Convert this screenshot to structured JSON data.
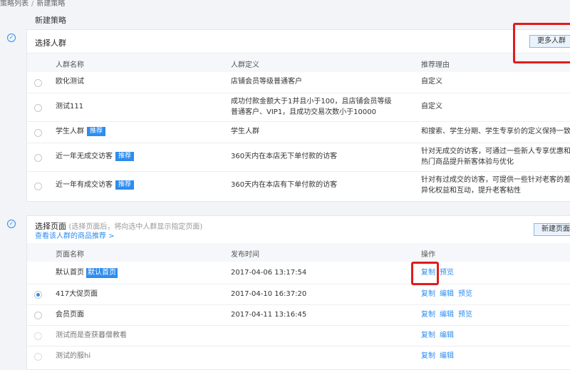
{
  "breadcrumb": {
    "parent": "策略列表",
    "separator": "/",
    "current": "新建策略"
  },
  "page_title": "新建策略",
  "crowd_section": {
    "title": "选择人群",
    "more_button": "更多人群",
    "columns": [
      "人群名称",
      "人群定义",
      "推荐理由"
    ],
    "rows": [
      {
        "name": "欧化测试",
        "tag": "",
        "definition": "店铺会员等级普通客户",
        "reason": "自定义"
      },
      {
        "name": "测试111",
        "tag": "",
        "definition": "成功付款金额大于1并且小于100，且店铺会员等级普通客户、VIP1，且成功交易次数小于10000",
        "reason": "自定义"
      },
      {
        "name": "学生人群",
        "tag": "推荐",
        "definition": "学生人群",
        "reason": "和搜索、学生分期、学生专享价的定义保持一致"
      },
      {
        "name": "近一年无成交访客",
        "tag": "推荐",
        "definition": "360天内在本店无下单付款的访客",
        "reason": "针对无成交的访客，可通过一些新人专享优惠和热门商品提升新客体验与优化"
      },
      {
        "name": "近一年有成交访客",
        "tag": "推荐",
        "definition": "360天内在本店有下单付款的访客",
        "reason": "针对有过成交的访客，可提供一些针对老客的差异化权益和互动，提升老客粘性"
      }
    ]
  },
  "page_section": {
    "title": "选择页面",
    "subtitle": "(选择页面后，将向选中人群显示指定页面)",
    "link": "查看该人群的商品推荐 >",
    "new_button": "新建页面",
    "columns": [
      "页面名称",
      "发布时间",
      "操作"
    ],
    "rows": [
      {
        "name": "默认首页",
        "tag": "默认首页",
        "time": "2017-04-06 13:17:54",
        "selected": false,
        "ops": [
          "复制",
          "预览"
        ]
      },
      {
        "name": "417大促页面",
        "tag": "",
        "time": "2017-04-10 16:37:20",
        "selected": true,
        "ops": [
          "复制",
          "编辑",
          "预览"
        ]
      },
      {
        "name": "会员页面",
        "tag": "",
        "time": "2017-04-11 13:16:45",
        "selected": false,
        "ops": [
          "复制",
          "编辑",
          "预览"
        ]
      },
      {
        "name": "测试而是查获暮僧教看",
        "tag": "",
        "time": "",
        "selected": false,
        "ops": [
          "复制",
          "编辑"
        ]
      },
      {
        "name": "测试的服hi",
        "tag": "",
        "time": "",
        "selected": false,
        "ops": [
          "复制",
          "编辑"
        ]
      }
    ]
  },
  "colors": {
    "accent": "#2d8cf0",
    "highlight": "#e01c1c"
  },
  "icons": {
    "step_check": "check-circle-icon",
    "radio": "radio-icon"
  }
}
